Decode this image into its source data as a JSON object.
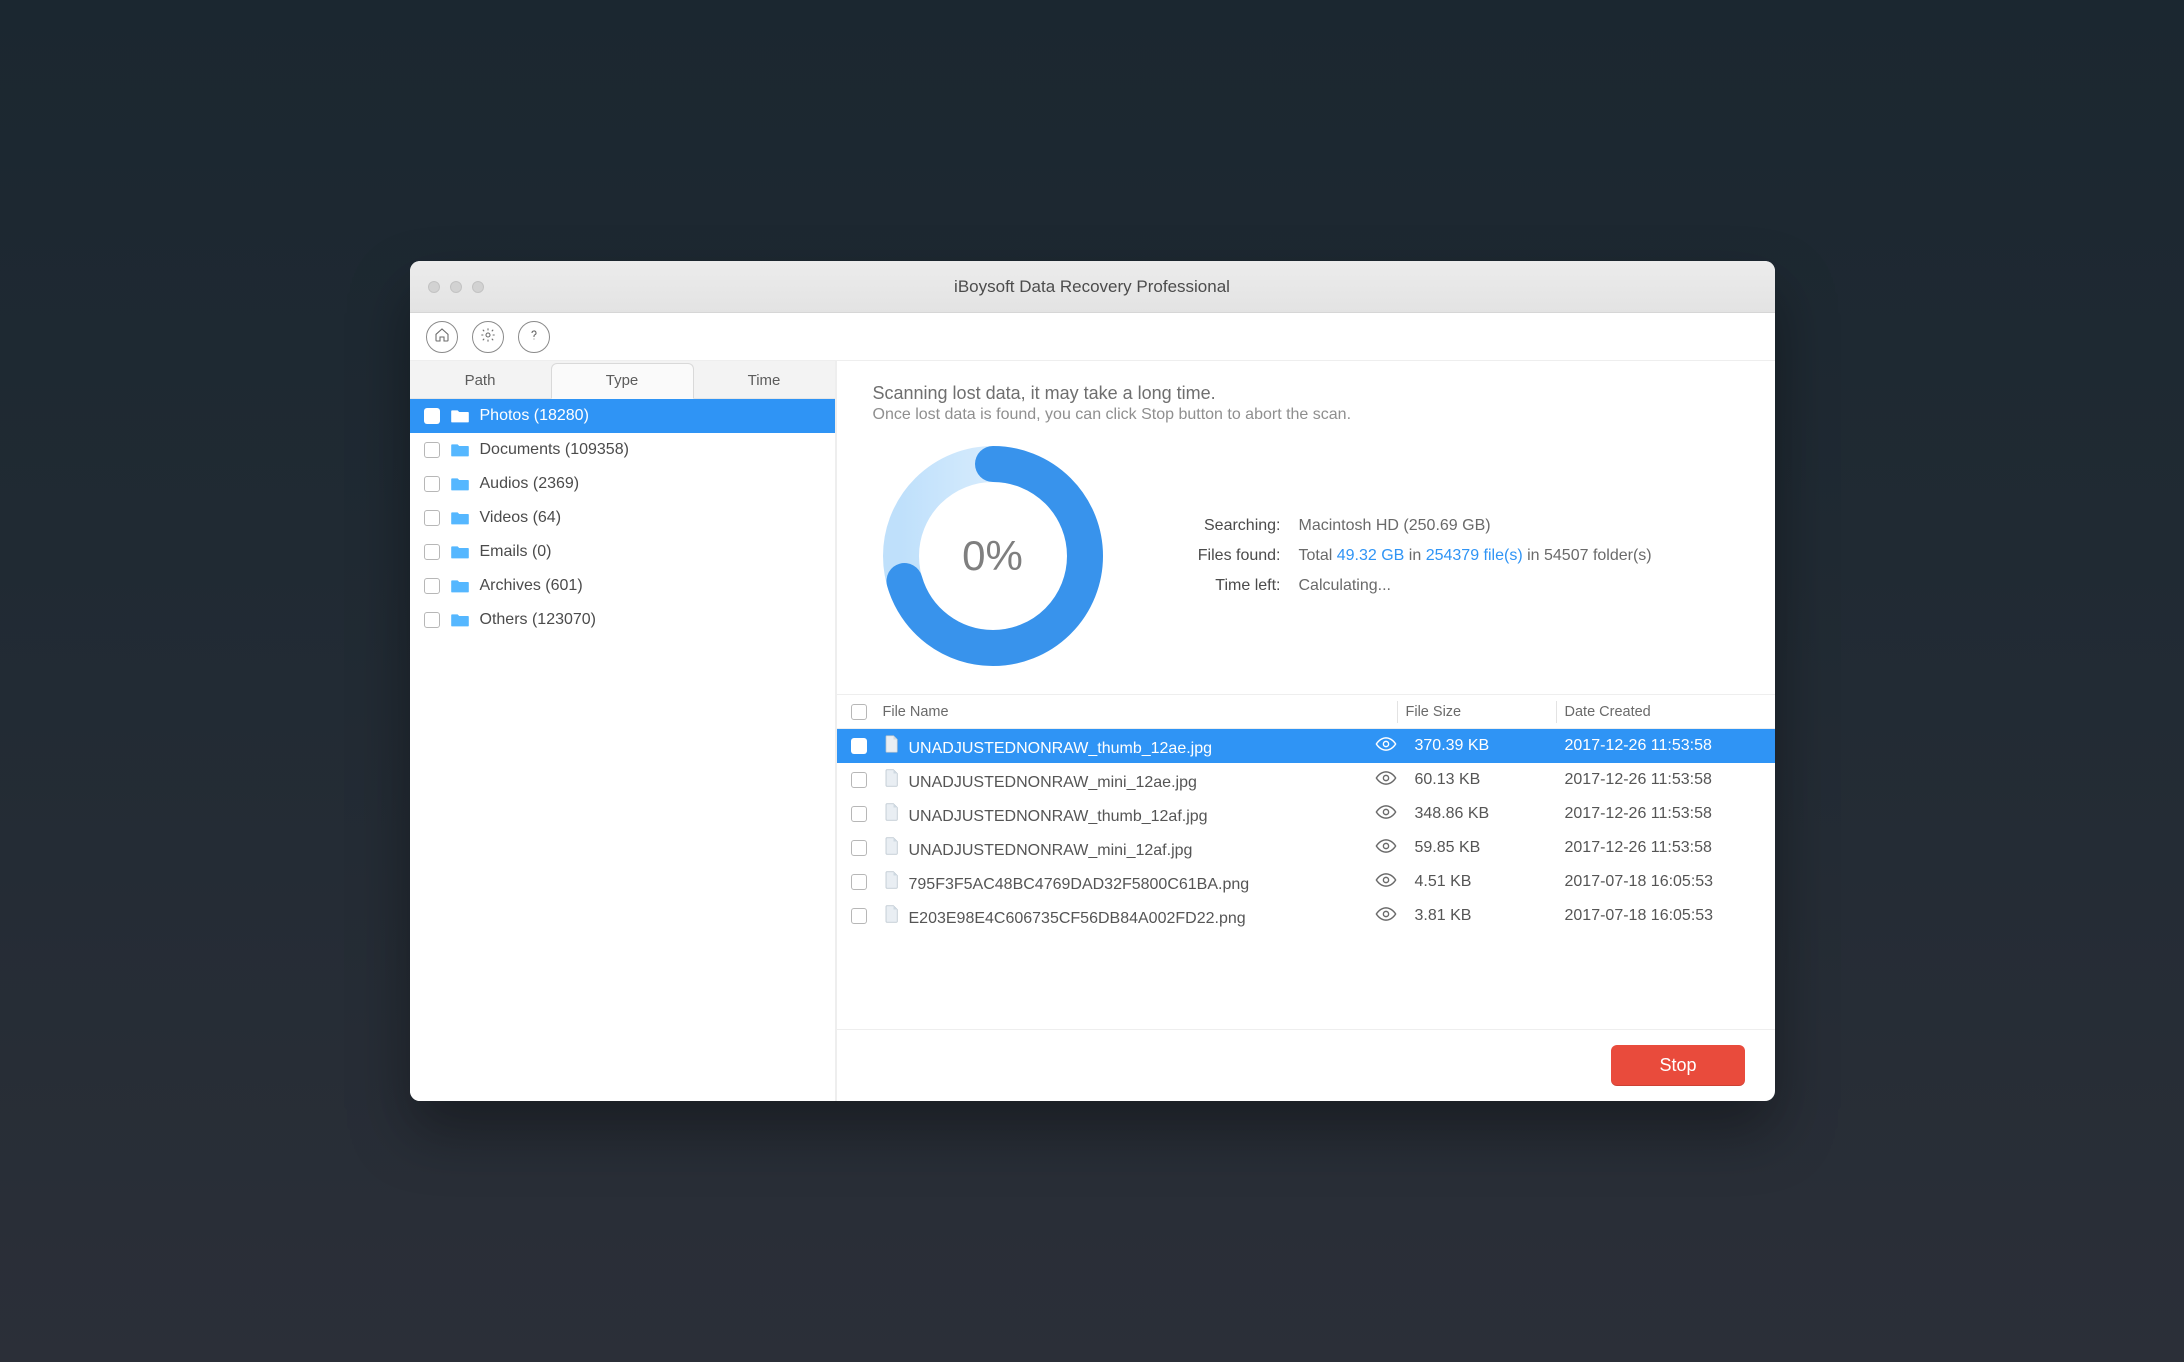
{
  "window": {
    "title": "iBoysoft Data Recovery Professional"
  },
  "toolbar": {
    "home_name": "home-icon",
    "settings_name": "gear-icon",
    "help_name": "help-icon"
  },
  "sidebar": {
    "tabs": [
      "Path",
      "Type",
      "Time"
    ],
    "active_tab": 1,
    "categories": [
      {
        "label": "Photos (18280)",
        "selected": true,
        "icon": "photos"
      },
      {
        "label": "Documents (109358)",
        "selected": false,
        "icon": "docs"
      },
      {
        "label": "Audios (2369)",
        "selected": false,
        "icon": "audio"
      },
      {
        "label": "Videos (64)",
        "selected": false,
        "icon": "video"
      },
      {
        "label": "Emails (0)",
        "selected": false,
        "icon": "email"
      },
      {
        "label": "Archives (601)",
        "selected": false,
        "icon": "archive"
      },
      {
        "label": "Others (123070)",
        "selected": false,
        "icon": "other"
      }
    ]
  },
  "scan": {
    "line1": "Scanning lost data, it may take a long time.",
    "line2": "Once lost data is found, you can click Stop button to abort the scan.",
    "percent_label": "0%",
    "searching_lbl": "Searching:",
    "searching_val": "Macintosh HD (250.69 GB)",
    "files_found_lbl": "Files found:",
    "ff_prefix": "Total ",
    "ff_size": "49.32 GB",
    "ff_in1": " in ",
    "ff_files": "254379 file(s)",
    "ff_in2": " in 54507 folder(s)",
    "time_left_lbl": "Time left:",
    "time_left_val": "Calculating..."
  },
  "table": {
    "headers": {
      "name": "File Name",
      "size": "File Size",
      "date": "Date Created"
    },
    "rows": [
      {
        "name": "UNADJUSTEDNONRAW_thumb_12ae.jpg",
        "size": "370.39 KB",
        "date": "2017-12-26 11:53:58",
        "selected": true
      },
      {
        "name": "UNADJUSTEDNONRAW_mini_12ae.jpg",
        "size": "60.13 KB",
        "date": "2017-12-26 11:53:58",
        "selected": false
      },
      {
        "name": "UNADJUSTEDNONRAW_thumb_12af.jpg",
        "size": "348.86 KB",
        "date": "2017-12-26 11:53:58",
        "selected": false
      },
      {
        "name": "UNADJUSTEDNONRAW_mini_12af.jpg",
        "size": "59.85 KB",
        "date": "2017-12-26 11:53:58",
        "selected": false
      },
      {
        "name": "795F3F5AC48BC4769DAD32F5800C61BA.png",
        "size": "4.51 KB",
        "date": "2017-07-18 16:05:53",
        "selected": false
      },
      {
        "name": "E203E98E4C606735CF56DB84A002FD22.png",
        "size": "3.81 KB",
        "date": "2017-07-18 16:05:53",
        "selected": false
      }
    ]
  },
  "footer": {
    "stop_label": "Stop"
  }
}
